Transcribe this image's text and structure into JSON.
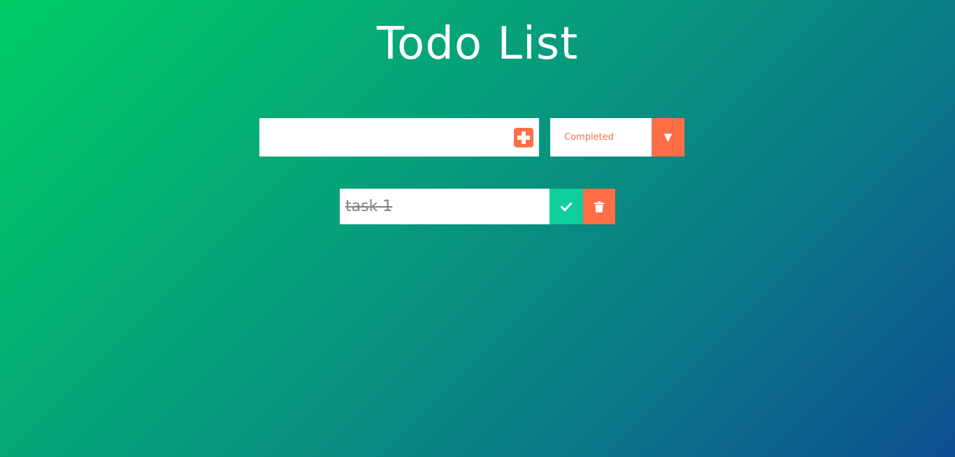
{
  "header": {
    "title": "Todo List"
  },
  "form": {
    "input_value": "",
    "input_placeholder": "",
    "add_icon": "plus-square-icon"
  },
  "filter": {
    "selected": "Completed",
    "arrow_glyph": "▼"
  },
  "todos": [
    {
      "text": "task 1",
      "completed": true,
      "complete_icon": "check-icon",
      "delete_icon": "trash-icon"
    }
  ],
  "colors": {
    "accent": "#ff6f47",
    "complete": "#0fcf9c",
    "gradient_start": "#00cc66",
    "gradient_end": "#0e4f92"
  }
}
